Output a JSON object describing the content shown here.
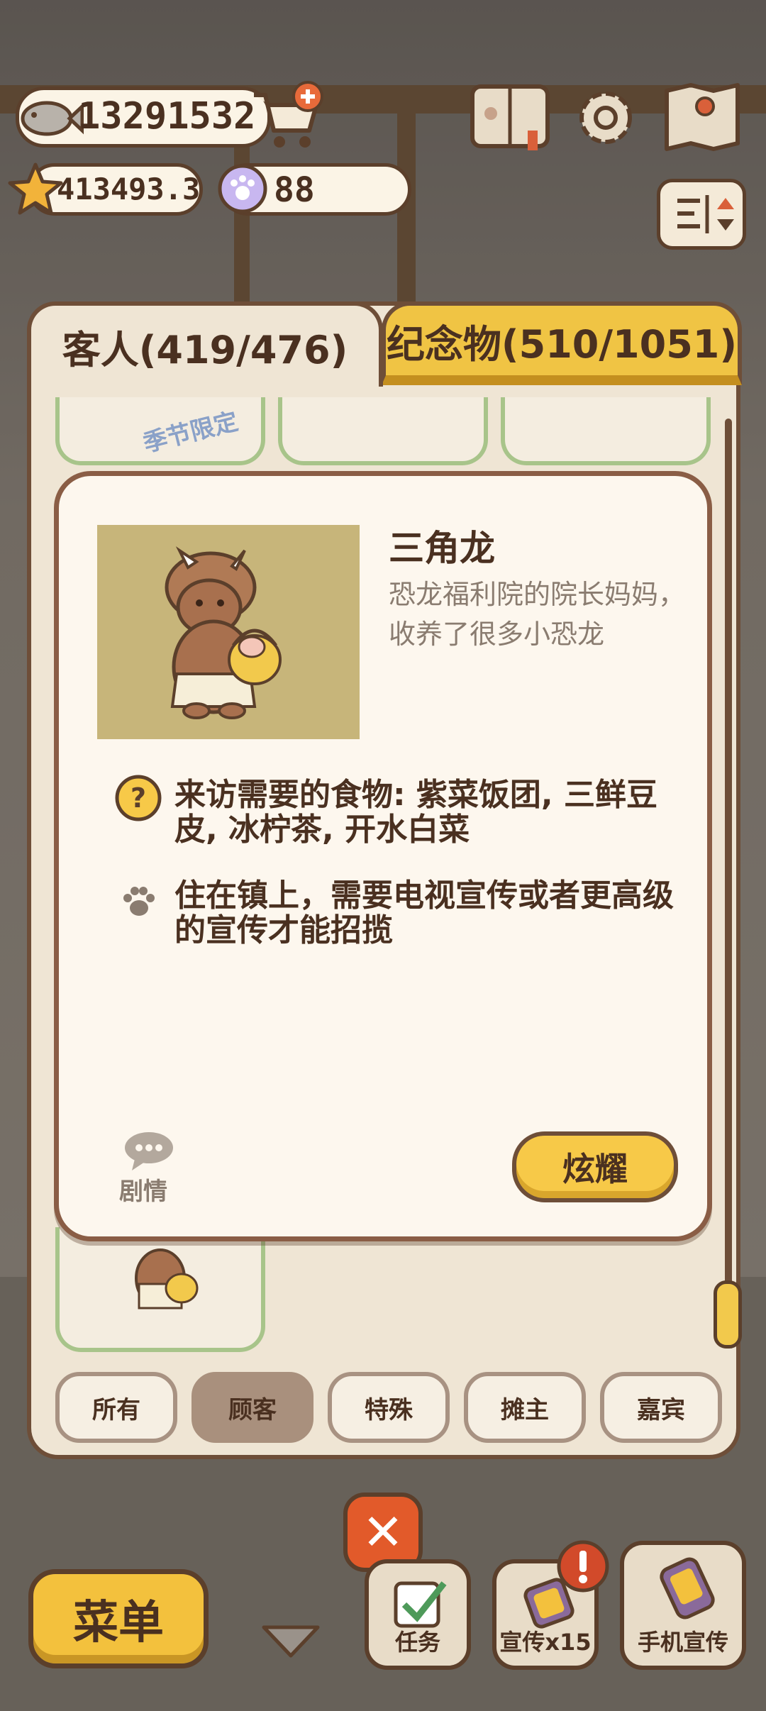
{
  "hud": {
    "fish_count": "13291532",
    "star_count": "413493.3",
    "paw_coin_count": "88"
  },
  "tabs": {
    "guests": "客人(419/476)",
    "souvenirs": "纪念物(510/1051)"
  },
  "card_badge": "季节限定",
  "detail": {
    "name": "三角龙",
    "description": "恐龙福利院的院长妈妈，收养了很多小恐龙",
    "food_requirement": "来访需要的食物: 紫菜饭团, 三鲜豆皮, 冰柠茶, 开水白菜",
    "visit_condition": "住在镇上，需要电视宣传或者更高级的宣传才能招揽",
    "story_label": "剧情",
    "show_off_button": "炫耀"
  },
  "filters": [
    "所有",
    "顾客",
    "特殊",
    "摊主",
    "嘉宾"
  ],
  "active_filter": "顾客",
  "bottom_bar": {
    "menu": "菜单",
    "tasks": "任务",
    "promo": "宣传x15",
    "phone_promo": "手机宣传"
  },
  "colors": {
    "panel_border": "#6e4e38",
    "souvenir_tab": "#f0c444",
    "button_yellow": "#f7c948",
    "close_red": "#e25a2a"
  }
}
